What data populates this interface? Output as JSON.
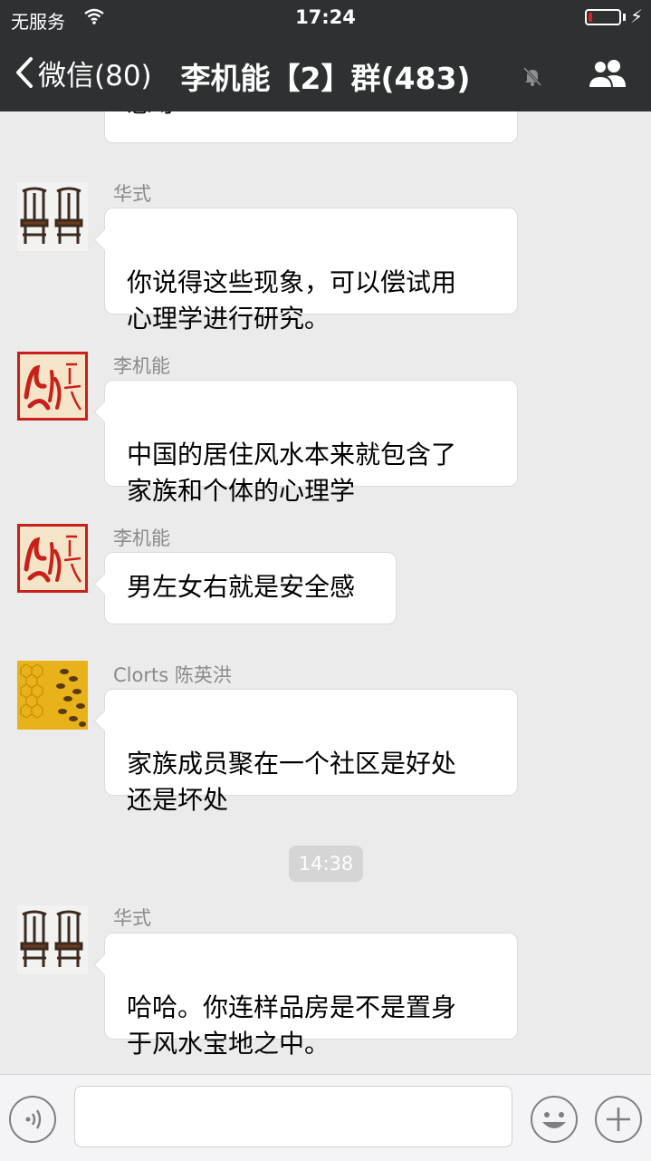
{
  "status_bar": {
    "carrier": "无服务",
    "time": "17:24",
    "battery_level": 0.12
  },
  "nav": {
    "back_label": "微信(80)",
    "title": "李机能【2】群(483)"
  },
  "chat": {
    "messages": [
      {
        "text": "感等"
      },
      {
        "sender": "华式",
        "avatar": "chairs-avatar",
        "text": "你说得这些现象，可以偿试用\n心理学进行研究。"
      },
      {
        "sender": "李机能",
        "avatar": "red-calligraphy-avatar",
        "text": "中国的居住风水本来就包含了\n家族和个体的心理学"
      },
      {
        "sender": "李机能",
        "avatar": "red-calligraphy-avatar",
        "text": "男左女右就是安全感"
      },
      {
        "sender": "Clorts 陈英洪",
        "avatar": "honeycomb-bees-avatar",
        "text": "家族成员聚在一个社区是好处\n还是坏处"
      },
      {
        "sender": "华式",
        "avatar": "chairs-avatar",
        "text": "哈哈。你连样品房是不是置身\n于风水宝地之中。"
      }
    ],
    "timestamp": "14:38"
  },
  "colors": {
    "topbar": "#2e3132",
    "background": "#ebebeb",
    "bubble": "#ffffff",
    "battery_low": "#e02020"
  }
}
